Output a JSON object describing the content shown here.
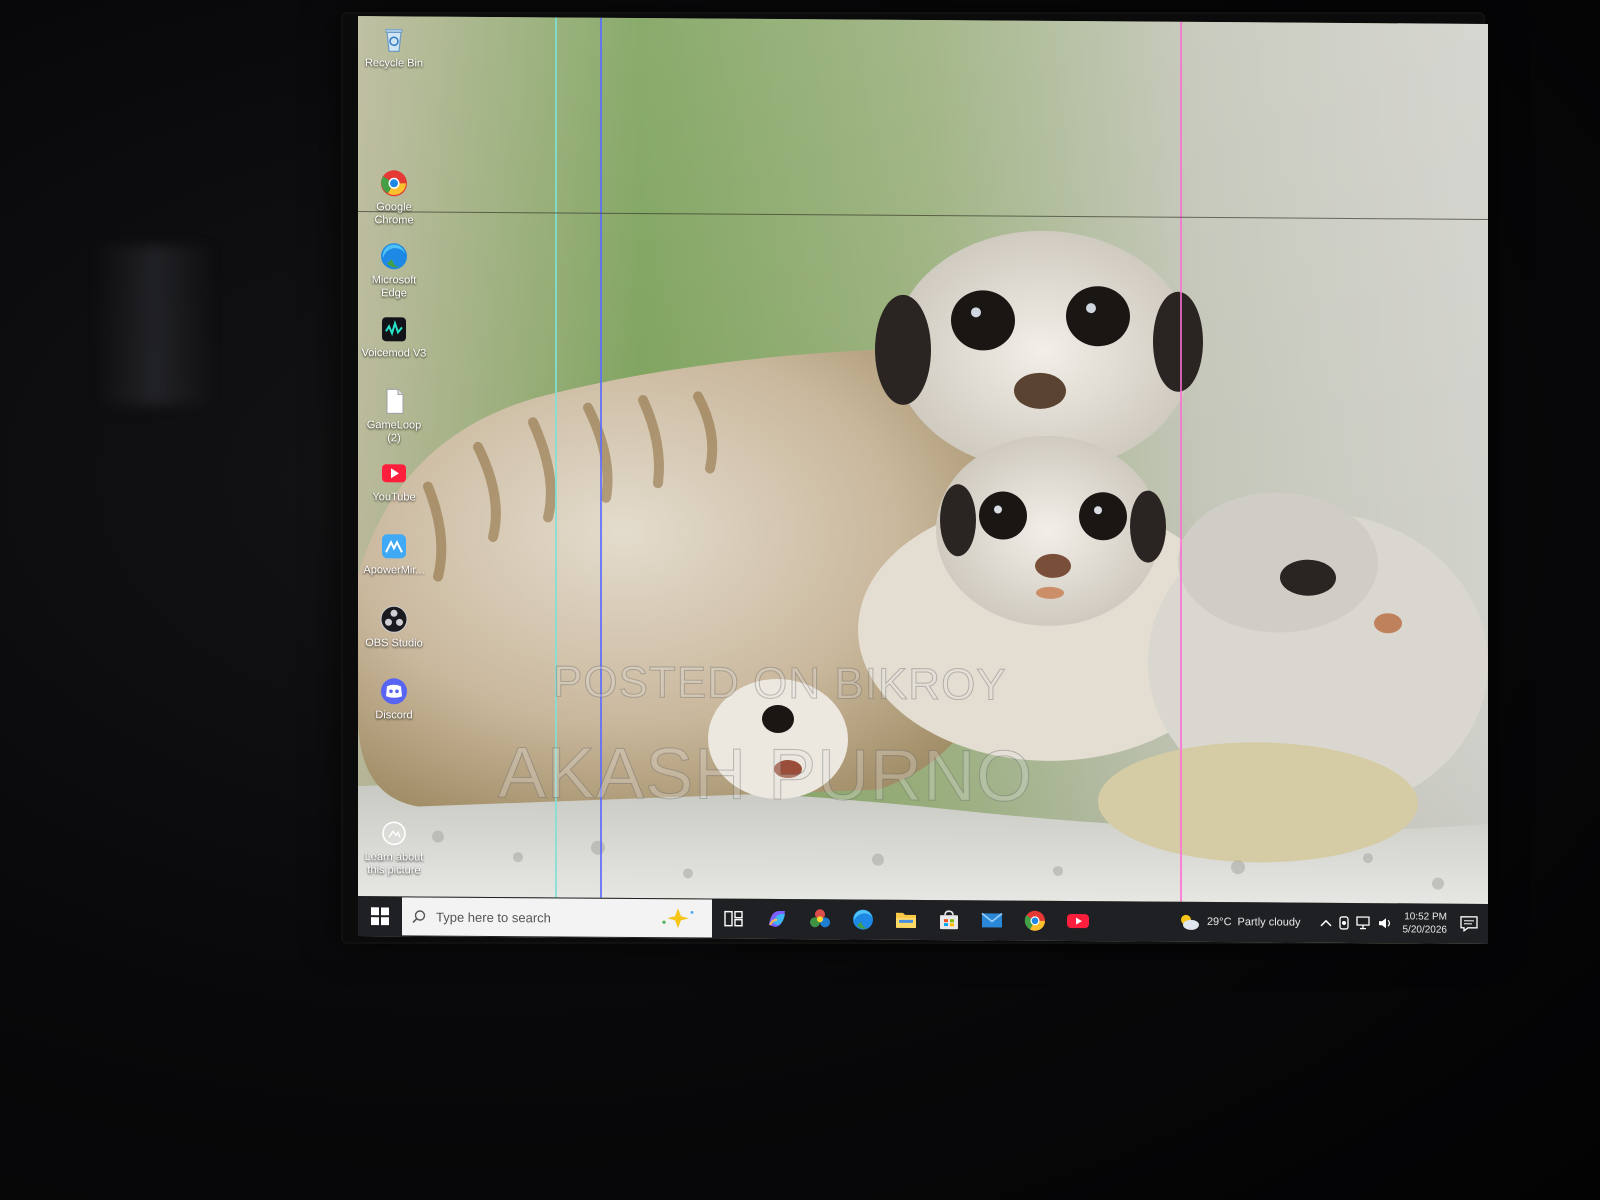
{
  "desktop": {
    "icons": [
      {
        "label": "Recycle Bin",
        "icon": "recycle-bin-icon"
      },
      {
        "label": "Google Chrome",
        "icon": "chrome-icon"
      },
      {
        "label": "Microsoft Edge",
        "icon": "edge-icon"
      },
      {
        "label": "Voicemod V3",
        "icon": "voicemod-icon"
      },
      {
        "label": "GameLoop (2)",
        "icon": "file-icon"
      },
      {
        "label": "YouTube",
        "icon": "youtube-icon"
      },
      {
        "label": "ApowerMir...",
        "icon": "apowermirror-icon"
      },
      {
        "label": "OBS Studio",
        "icon": "obs-icon"
      },
      {
        "label": "Discord",
        "icon": "discord-icon"
      },
      {
        "label": "Learn about this picture",
        "icon": "camera-icon"
      }
    ]
  },
  "watermark": {
    "line1": "POSTED ON BIKROY",
    "line2": "AKASH PURNO"
  },
  "taskbar": {
    "search_placeholder": "Type here to search",
    "apps": [
      "task-view-icon",
      "copilot-icon",
      "photos-icon",
      "edge-icon",
      "file-explorer-icon",
      "store-icon",
      "mail-icon",
      "chrome-icon",
      "youtube-icon"
    ],
    "weather_temp": "29°C",
    "weather_desc": "Partly cloudy",
    "time": "10:52 PM",
    "date": "5/20/2026"
  },
  "colors": {
    "taskbar": "#1f2024",
    "search": "#f3f3f3",
    "chrome_red": "#e53935",
    "edge_blue": "#1e88e5",
    "youtube_red": "#ff1f3d"
  }
}
